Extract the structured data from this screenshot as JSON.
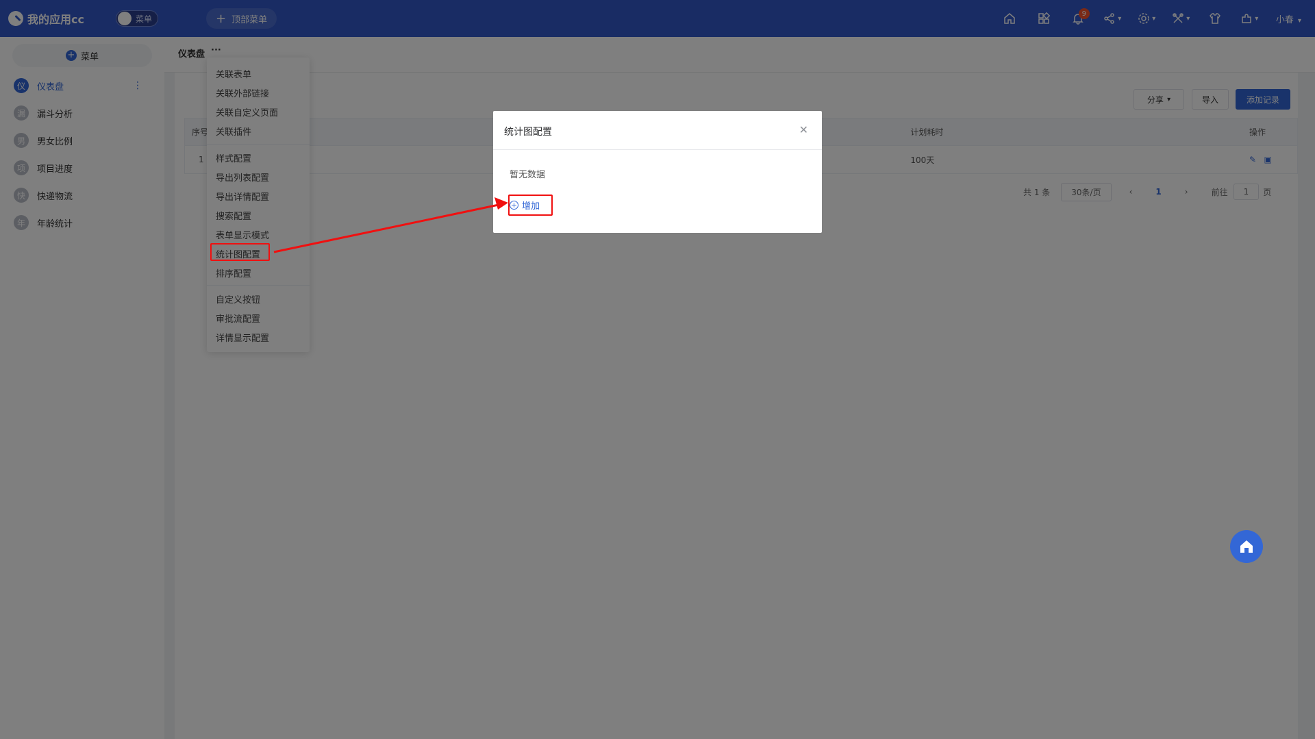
{
  "header": {
    "app_title": "我的应用cc",
    "toggle_label": "菜单",
    "top_menu_label": "顶部菜单",
    "notification_count": "9",
    "user_name": "小春"
  },
  "sidebar": {
    "add_menu_label": "菜单",
    "items": [
      {
        "avatar": "仪",
        "label": "仪表盘"
      },
      {
        "avatar": "漏",
        "label": "漏斗分析"
      },
      {
        "avatar": "男",
        "label": "男女比例"
      },
      {
        "avatar": "项",
        "label": "项目进度"
      },
      {
        "avatar": "快",
        "label": "快递物流"
      },
      {
        "avatar": "年",
        "label": "年龄统计"
      }
    ]
  },
  "breadcrumb": {
    "title": "仪表盘",
    "more": "···"
  },
  "toolbar": {
    "share_label": "分享",
    "import_label": "导入",
    "add_record_label": "添加记录"
  },
  "table": {
    "headers": {
      "index": "序号",
      "plan_time": "计划耗时",
      "actions": "操作"
    },
    "rows": [
      {
        "index": "1",
        "plan_time": "100天"
      }
    ]
  },
  "pagination": {
    "total": "共 1 条",
    "page_size": "30条/页",
    "current": "1",
    "goto_label": "前往",
    "goto_value": "1",
    "page_unit": "页"
  },
  "dropdown": {
    "items": [
      "关联表单",
      "关联外部链接",
      "关联自定义页面",
      "关联插件",
      "样式配置",
      "导出列表配置",
      "导出详情配置",
      "搜索配置",
      "表单显示模式",
      "统计图配置",
      "排序配置",
      "自定义按钮",
      "审批流配置",
      "详情显示配置"
    ]
  },
  "dialog": {
    "title": "统计图配置",
    "empty_text": "暂无数据",
    "add_label": "增加"
  },
  "colors": {
    "primary": "#3367d6",
    "header": "#3358c8",
    "highlight": "#f01010"
  }
}
